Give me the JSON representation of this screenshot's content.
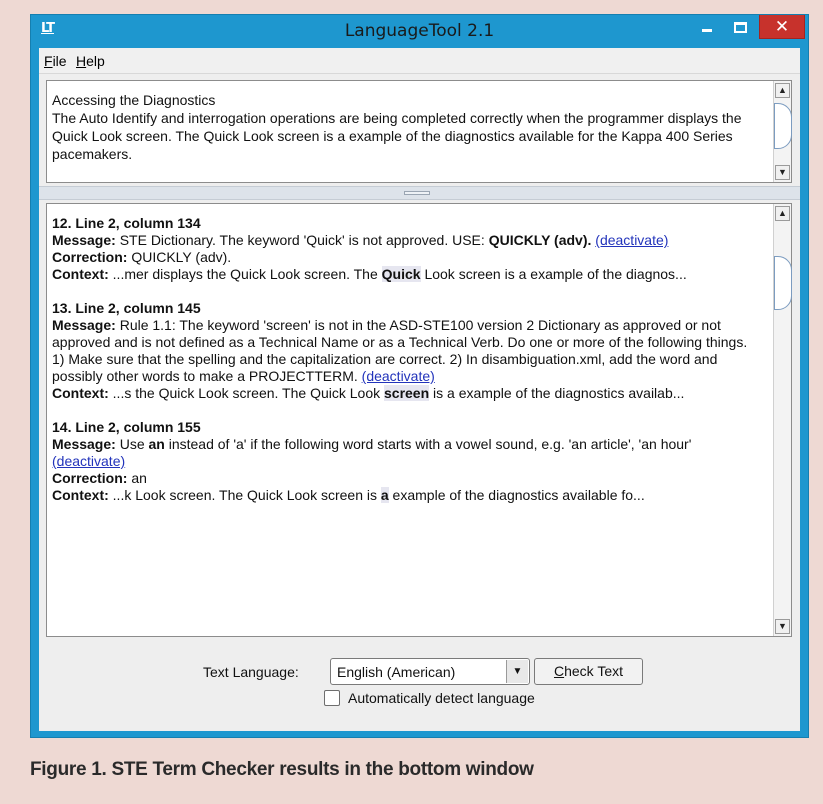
{
  "window": {
    "icon_text": "LT",
    "title": "LanguageTool 2.1",
    "close_glyph": "✕"
  },
  "menu": {
    "file_mnemonic": "F",
    "file_rest": "ile",
    "help_mnemonic": "H",
    "help_rest": "elp"
  },
  "input": {
    "line1": "Accessing the Diagnostics",
    "line2": "The Auto Identify and interrogation operations are being completed correctly when the programmer displays the Quick Look screen. The Quick Look screen is a example of the diagnostics available for the Kappa 400 Series pacemakers."
  },
  "results": [
    {
      "header": "12. Line 2, column 134",
      "message_label": "Message:",
      "message_pre": " STE Dictionary. The keyword 'Quick' is not approved. USE: ",
      "message_bold": "QUICKLY (adv).",
      "deactivate": "(deactivate)",
      "correction_label": "Correction:",
      "correction": " QUICKLY (adv).",
      "context_label": "Context:",
      "context_pre": " ...mer displays the Quick Look screen. The ",
      "context_hl": "Quick",
      "context_post": " Look screen is a example of the diagnos..."
    },
    {
      "header": "13. Line 2, column 145",
      "message_label": "Message:",
      "message": " Rule 1.1: The keyword 'screen' is not in the ASD-STE100 version 2 Dictionary as approved or not approved and is not defined as a Technical Name or as a Technical Verb. Do one or more of the following things. 1) Make sure that the spelling and the capitalization are correct. 2) In disambiguation.xml, add the word and possibly other words to make a PROJECTTERM.",
      "deactivate": "(deactivate)",
      "context_label": "Context:",
      "context_pre": " ...s the Quick Look screen. The Quick Look ",
      "context_hl": "screen",
      "context_post": " is a example of the diagnostics availab..."
    },
    {
      "header": "14. Line 2, column 155",
      "message_label": "Message:",
      "message_pre": " Use ",
      "message_bold": "an",
      "message_post": " instead of 'a' if the following word starts with a vowel sound, e.g. 'an article', 'an hour'",
      "deactivate": "(deactivate)",
      "correction_label": "Correction:",
      "correction": " an",
      "context_label": "Context:",
      "context_pre": " ...k Look screen. The Quick Look screen is ",
      "context_hl": "a",
      "context_post": " example of the diagnostics available fo..."
    }
  ],
  "controls": {
    "language_label": "Text Language:",
    "language_value": "English (American)",
    "check_mnemonic": "C",
    "check_rest": "heck Text",
    "auto_detect_label": "Automatically detect language",
    "auto_detect_checked": false
  },
  "caption": "Figure 1. STE Term Checker results in the bottom window"
}
